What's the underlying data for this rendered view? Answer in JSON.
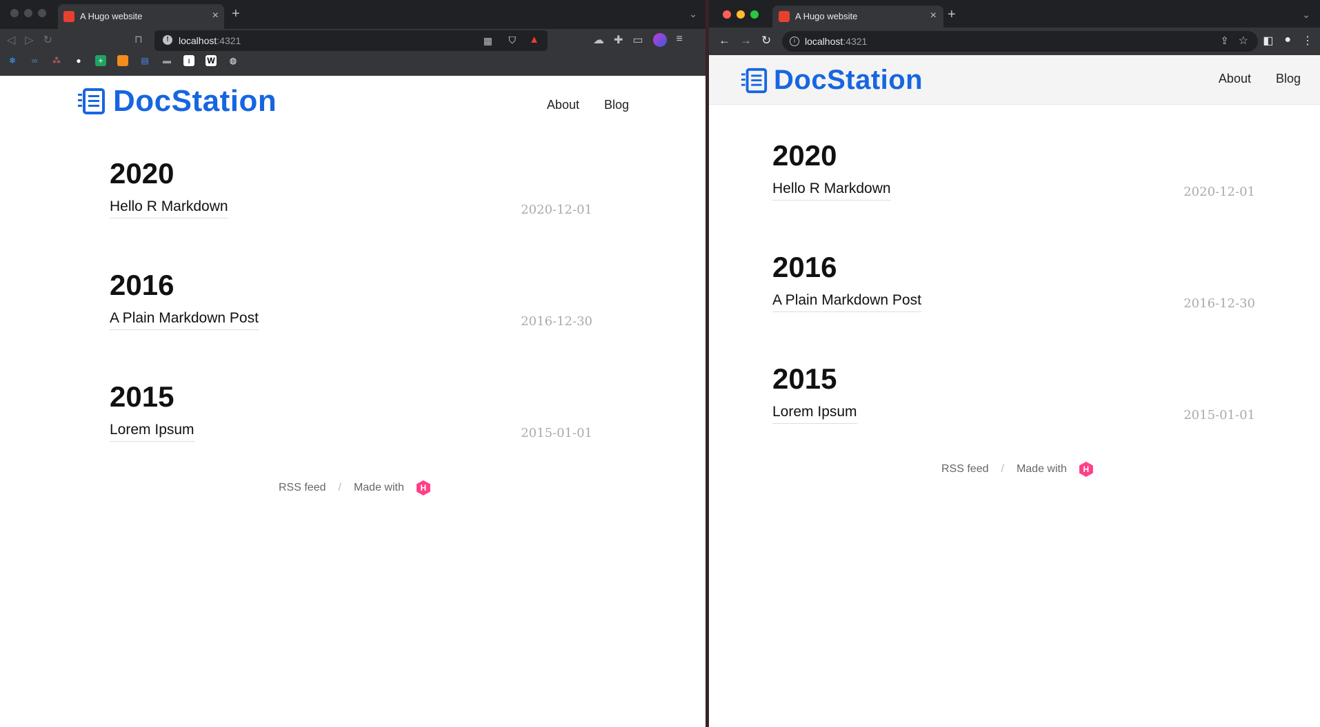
{
  "browser": {
    "tab_title": "A Hugo website",
    "url_host": "localhost",
    "url_port": ":4321"
  },
  "site": {
    "logo_text": "DocStation",
    "nav": [
      {
        "label": "About"
      },
      {
        "label": "Blog"
      }
    ],
    "groups": [
      {
        "year": "2020",
        "posts": [
          {
            "title": "Hello R Markdown",
            "date": "2020-12-01"
          }
        ]
      },
      {
        "year": "2016",
        "posts": [
          {
            "title": "A Plain Markdown Post",
            "date": "2016-12-30"
          }
        ]
      },
      {
        "year": "2015",
        "posts": [
          {
            "title": "Lorem Ipsum",
            "date": "2015-01-01"
          }
        ]
      }
    ],
    "footer": {
      "rss": "RSS feed",
      "separator": "/",
      "made_with": "Made with",
      "hugo_badge": "H"
    }
  }
}
